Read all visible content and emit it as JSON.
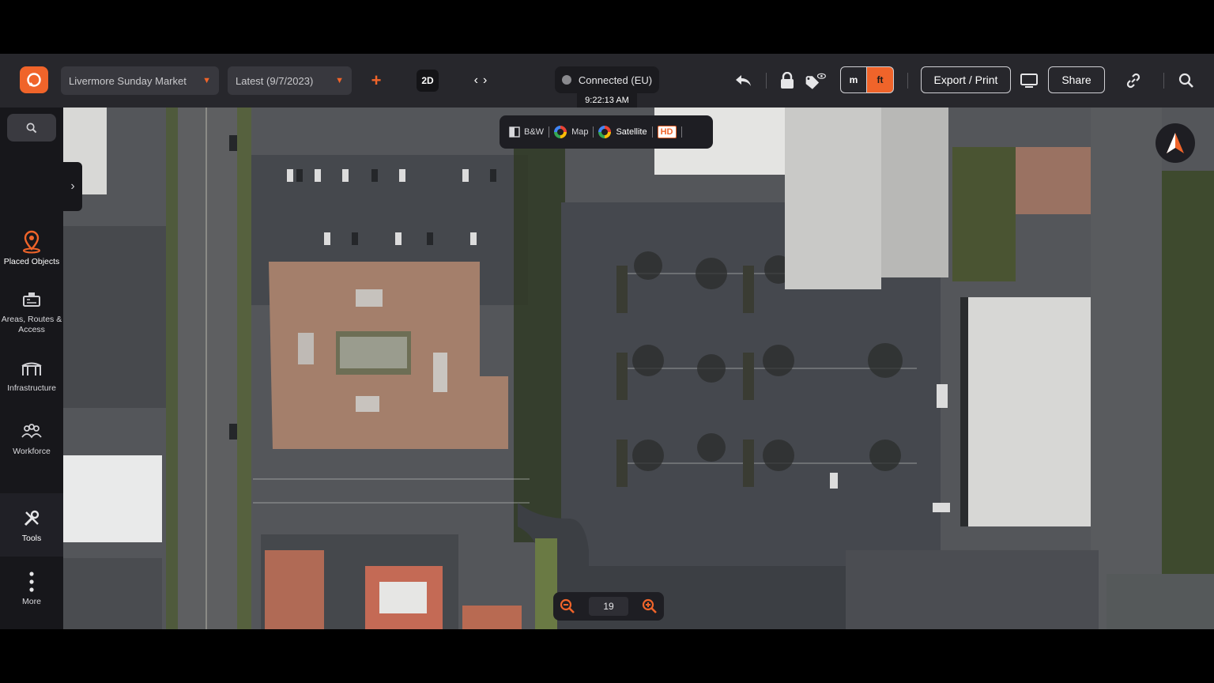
{
  "toolbar": {
    "project_select": "Livermore Sunday Market",
    "version_select": "Latest (9/7/2023)",
    "view_mode": "2D",
    "connection_status": "Connected (EU)",
    "time": "9:22:13 AM",
    "unit_m": "m",
    "unit_ft": "ft",
    "export_label": "Export / Print",
    "share_label": "Share",
    "accent_color": "#f0642a"
  },
  "sidebar": {
    "items": [
      {
        "label": "Placed Objects",
        "icon": "map-pin-icon"
      },
      {
        "label": "Areas, Routes & Access",
        "icon": "route-icon"
      },
      {
        "label": "Infrastructure",
        "icon": "tent-icon"
      },
      {
        "label": "Workforce",
        "icon": "people-icon"
      },
      {
        "label": "Tools",
        "icon": "tools-icon"
      },
      {
        "label": "More",
        "icon": "more-vertical-icon"
      }
    ]
  },
  "map_layers": {
    "bw": "B&W",
    "map": "Map",
    "satellite": "Satellite",
    "hd": "HD"
  },
  "zoom": {
    "level": "19"
  }
}
